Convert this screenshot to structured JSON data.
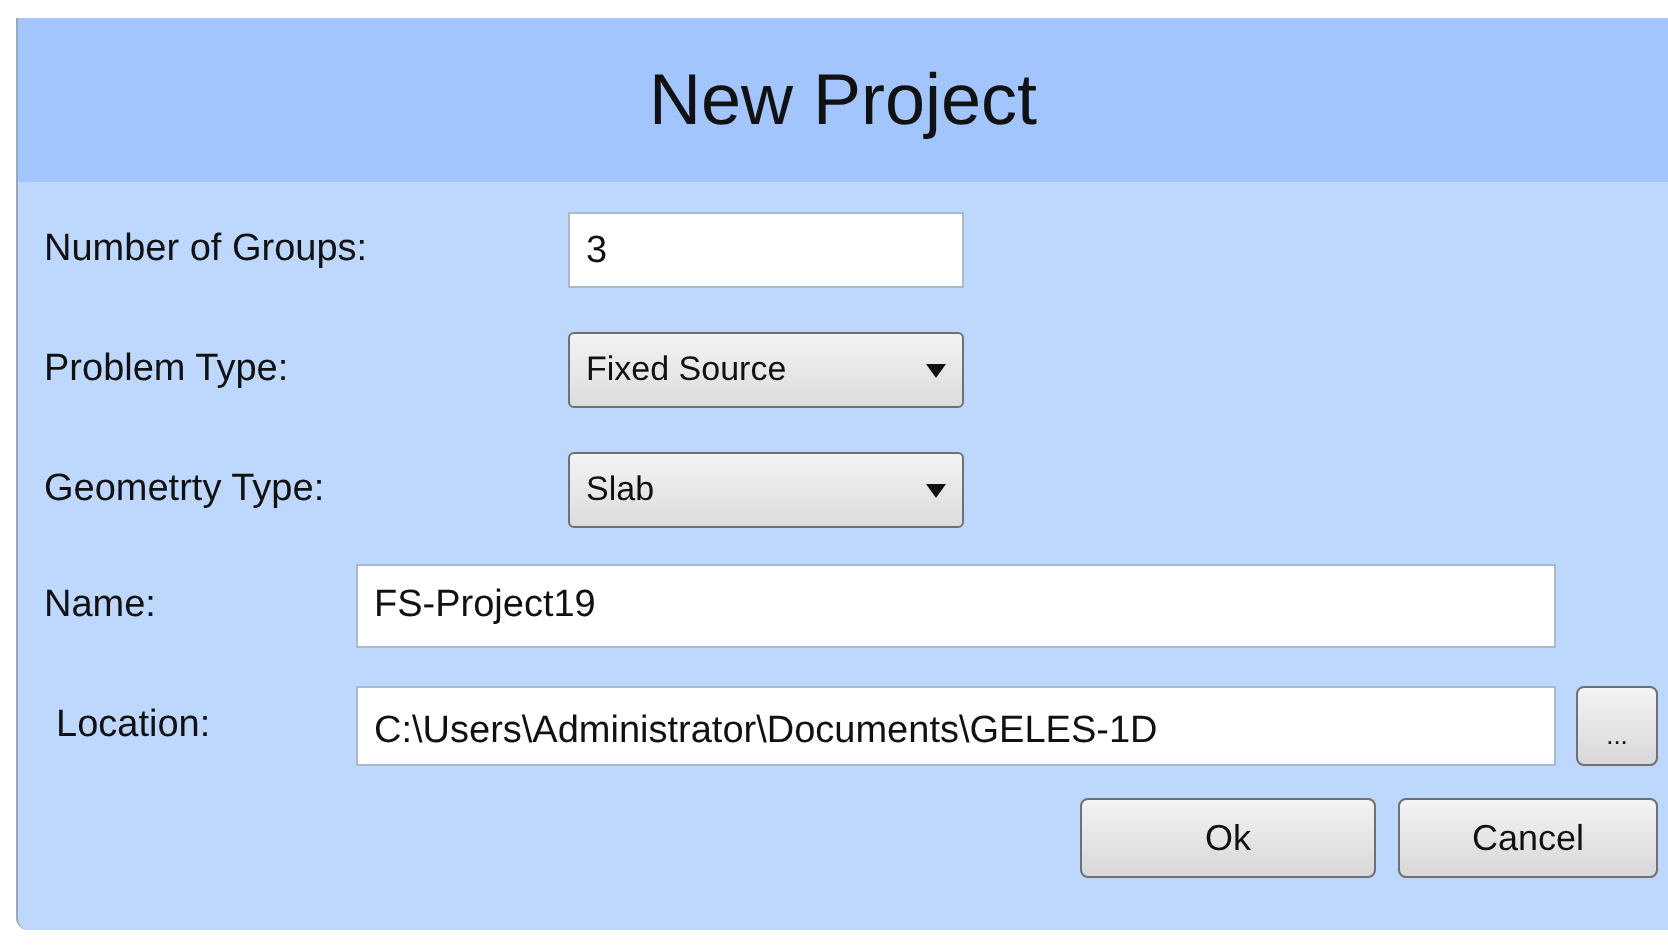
{
  "window": {
    "title": "New Project"
  },
  "fields": [
    {
      "kind": "text",
      "label": "Number of Groups:",
      "value": "3"
    },
    {
      "kind": "dropdown",
      "label": "Problem Type:",
      "value": "Fixed Source"
    },
    {
      "kind": "dropdown",
      "label": "Geometrty Type:",
      "value": "Slab"
    },
    {
      "kind": "wide",
      "label": "Name:",
      "value": "FS-Project19"
    },
    {
      "kind": "browse",
      "label": "Location:",
      "value": "C:\\Users\\Administrator\\Documents\\GELES-1D",
      "button": "..."
    }
  ],
  "buttons": [
    "Ok",
    "Cancel"
  ]
}
